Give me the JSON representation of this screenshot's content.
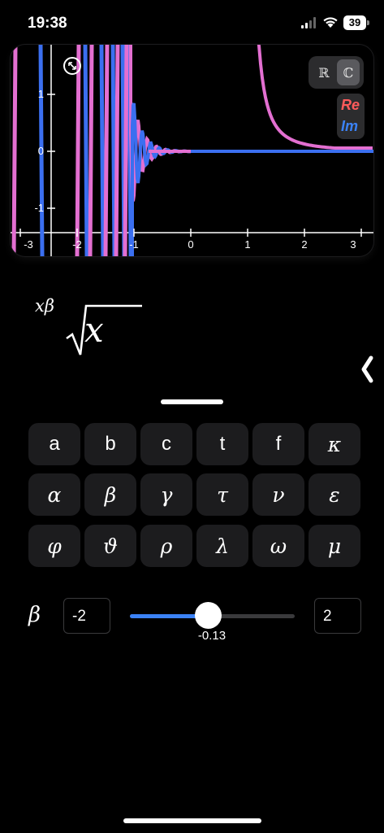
{
  "status": {
    "time": "19:38",
    "battery": "39",
    "icons": [
      "signal-icon",
      "wifi-icon",
      "battery-icon"
    ]
  },
  "graph": {
    "x_ticks": [
      "-3",
      "-2",
      "-1",
      "0",
      "1",
      "2",
      "3"
    ],
    "y_ticks": [
      "1",
      "0",
      "-1"
    ],
    "mode_real": "ℝ",
    "mode_complex": "ℂ",
    "active_mode": "complex",
    "legend_re": "Re",
    "legend_im": "Im",
    "colors": {
      "re": "#e36fd1",
      "im": "#3b6ff0",
      "axis": "#ffffff"
    }
  },
  "formula": {
    "exponent": "xβ",
    "base": "x"
  },
  "keyboard": {
    "rows": [
      [
        "a",
        "b",
        "c",
        "t",
        "f",
        "κ"
      ],
      [
        "α",
        "β",
        "γ",
        "τ",
        "ν",
        "ε"
      ],
      [
        "φ",
        "ϑ",
        "ρ",
        "λ",
        "ω",
        "μ"
      ]
    ]
  },
  "parameter": {
    "name": "β",
    "min": "-2",
    "max": "2",
    "value": "-0.13",
    "fraction": 0.47
  },
  "accent_color": "#3b82f6"
}
